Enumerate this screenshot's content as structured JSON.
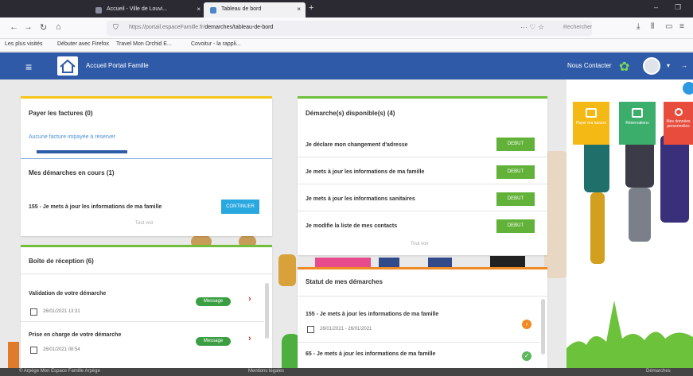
{
  "browser": {
    "tabs": [
      {
        "label": "Accueil - Ville de Louvi..."
      },
      {
        "label": "Tableau de bord"
      }
    ],
    "url_prefix": "https://portail.espaceFamille.fr/",
    "url_path": "demarches/tableau-de-bord",
    "search_placeholder": "Rechercher",
    "bookmarks": [
      "Les plus visités",
      "Débuter avec Firefox",
      "Travel Mon Orchid E...",
      "Covoitur - la rappli..."
    ]
  },
  "header": {
    "app_title": "Accueil Portail Famille",
    "contact_label": "Nous Contacter"
  },
  "factures": {
    "title": "Payer les factures (0)",
    "empty_text": "Aucune facture impayée à réserver"
  },
  "demarches_en_cours": {
    "title": "Mes démarches en cours (1)",
    "item_text": "155 - Je mets à jour les informations de ma famille",
    "continue_label": "CONTINUER",
    "see_all": "Tout voir"
  },
  "boite_reception": {
    "title": "Boîte de réception (6)",
    "messages": [
      {
        "subject": "Validation de votre démarche",
        "date": "26/01/2021 13:31",
        "badge": "Message"
      },
      {
        "subject": "Prise en charge de votre démarche",
        "date": "26/01/2021 08:54",
        "badge": "Message"
      }
    ]
  },
  "demarches_disponibles": {
    "title": "Démarche(s) disponible(s) (4)",
    "items": [
      {
        "label": "Je déclare mon changement d'adresse",
        "button": "DEBUT"
      },
      {
        "label": "Je mets à jour les informations de ma famille",
        "button": "DEBUT"
      },
      {
        "label": "Je mets à jour les informations sanitaires",
        "button": "DEBUT"
      },
      {
        "label": "Je modifie la liste de mes contacts",
        "button": "DEBUT"
      }
    ],
    "see_all": "Tout voir"
  },
  "statut": {
    "title": "Statut de mes démarches",
    "items": [
      {
        "label": "155 - Je mets à jour les informations de ma famille",
        "date": "26/01/2021 - 26/01/2021",
        "status_color": "#f08a24"
      },
      {
        "label": "65 - Je mets à jour les informations de ma famille",
        "status_color": "#5cb85c"
      }
    ]
  },
  "tiles": [
    {
      "label": "Payer ma facture",
      "color": "#f5b916"
    },
    {
      "label": "Réservations",
      "color": "#3cae6b"
    },
    {
      "label": "Mes données personnelles",
      "color": "#e84c3d"
    }
  ],
  "statusbar": {
    "left": "© Arpège Mon Espace Famille Arpège",
    "middle": "Mentions légales",
    "right": "Démarches"
  },
  "colors": {
    "header_blue": "#2e5aa8",
    "accent_green": "#62b23a",
    "accent_yellow": "#f5c518",
    "accent_blue": "#29a8e0"
  }
}
